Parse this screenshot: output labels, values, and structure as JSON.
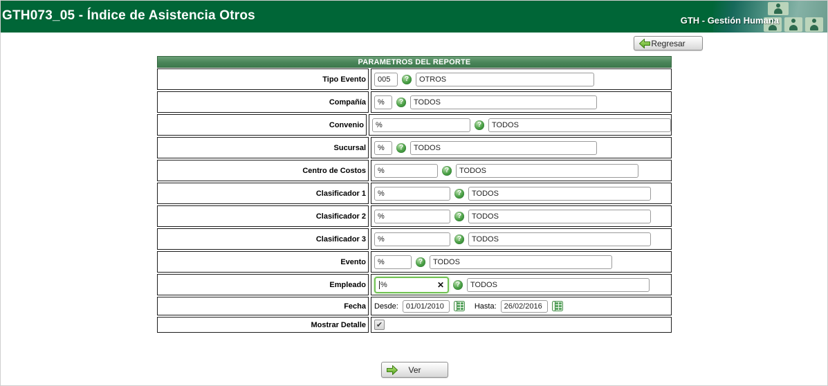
{
  "header": {
    "title": "GTH073_05 - Índice de Asistencia Otros",
    "brand": "GTH - Gestión Humana"
  },
  "toolbar": {
    "back_label": "Regresar"
  },
  "report": {
    "title": "PARAMETROS DEL REPORTE",
    "rows": [
      {
        "label": "Tipo Evento",
        "code": "005",
        "desc": "OTROS"
      },
      {
        "label": "Compañía",
        "code": "%",
        "desc": "TODOS"
      },
      {
        "label": "Convenio",
        "code": "%",
        "desc": "TODOS"
      },
      {
        "label": "Sucursal",
        "code": "%",
        "desc": "TODOS"
      },
      {
        "label": "Centro de Costos",
        "code": "%",
        "desc": "TODOS"
      },
      {
        "label": "Clasificador 1",
        "code": "%",
        "desc": "TODOS"
      },
      {
        "label": "Clasificador 2",
        "code": "%",
        "desc": "TODOS"
      },
      {
        "label": "Clasificador 3",
        "code": "%",
        "desc": "TODOS"
      },
      {
        "label": "Evento",
        "code": "%",
        "desc": "TODOS"
      },
      {
        "label": "Empleado",
        "code": "%",
        "desc": "TODOS",
        "focused": true
      }
    ],
    "fecha": {
      "label": "Fecha",
      "desde_label": "Desde:",
      "desde_value": "01/01/2010",
      "hasta_label": "Hasta:",
      "hasta_value": "26/02/2016"
    },
    "detalle": {
      "label": "Mostrar Detalle",
      "checked": true
    }
  },
  "actions": {
    "ver_label": "Ver"
  },
  "icons": {
    "back_arrow": "arrow-left",
    "forward_arrow": "arrow-right",
    "help": "question-mark-circle",
    "calendar": "calendar-grid",
    "clear": "x-mark",
    "checkbox_check": "check-mark",
    "people": "person-tiles"
  },
  "colors": {
    "header_green": "#006637",
    "panel_green": "#4a8459",
    "focus_green": "#72c254",
    "arrow_green": "#56a71f",
    "border_dark": "#1b1b1b"
  }
}
